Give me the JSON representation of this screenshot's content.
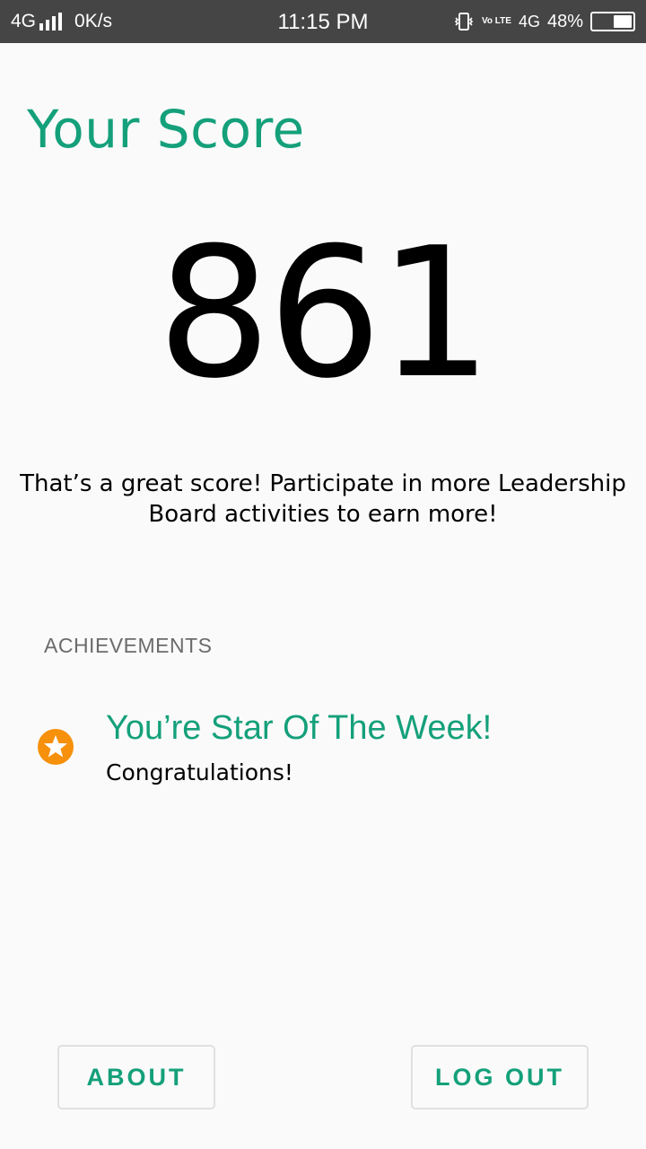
{
  "status_bar": {
    "network": "4G",
    "speed": "0K/s",
    "time": "11:15 PM",
    "volte": "Vo LTE",
    "network_right": "4G",
    "battery": "48%",
    "battery_level": 0.48
  },
  "score": {
    "title": "Your Score",
    "value": "861",
    "message": "That’s a great score! Participate in more Leadership Board activities to earn more!"
  },
  "achievements": {
    "header": "ACHIEVEMENTS",
    "items": [
      {
        "icon": "star-badge-icon",
        "title": "You’re Star Of The Week!",
        "subtitle": "Congratulations!"
      }
    ]
  },
  "buttons": {
    "about": "ABOUT",
    "logout": "LOG OUT"
  },
  "colors": {
    "accent": "#14a07a",
    "star_badge": "#f7900a",
    "status_bar": "#454545"
  }
}
